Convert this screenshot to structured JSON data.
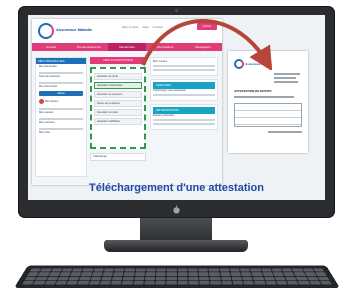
{
  "caption": "Téléchargement d'une attestation",
  "app": {
    "brand": "Assurance Maladie",
    "top_links": [
      "Mon compte",
      "Aide",
      "Contact"
    ],
    "logout_label": "Quitter",
    "nav": [
      {
        "label": "Accueil",
        "active": false
      },
      {
        "label": "Remboursements",
        "active": false
      },
      {
        "label": "Démarches",
        "active": true
      },
      {
        "label": "Informations",
        "active": false
      },
      {
        "label": "Messagerie",
        "active": false
      }
    ],
    "left_panel": {
      "title": "MES DÉMARCHES",
      "items": [
        "Mes demandes",
        "Suivi des dossiers",
        "Mes documents"
      ],
      "button_label": "Valider",
      "alert_label": "Mes alertes",
      "links": [
        "Mon espace",
        "Mes courriers",
        "Mes infos"
      ]
    },
    "middle_panel": {
      "title": "MES ATTESTATIONS",
      "items": [
        {
          "label": "Attestation de droits",
          "highlight": false
        },
        {
          "label": "Attestation d'indemnités",
          "highlight": true
        },
        {
          "label": "Attestation de paiement",
          "highlight": false
        },
        {
          "label": "Relevé de prestations",
          "highlight": false
        },
        {
          "label": "Attestation de vitale",
          "highlight": false
        },
        {
          "label": "Attestation d'affiliation",
          "highlight": false
        }
      ],
      "footer_label": "Télécharger"
    },
    "right_panel": {
      "cards": [
        {
          "title": "",
          "text": "Mon compte"
        },
        {
          "title": "SERVICES",
          "text": "Télécharger votre attestation"
        },
        {
          "title": "INFORMATIONS",
          "text": "Espace prévention"
        }
      ]
    }
  },
  "document": {
    "brand": "Assurance Maladie",
    "title": "ATTESTATION DE DROITS"
  },
  "colors": {
    "brand_blue": "#1d6fb8",
    "brand_pink": "#e23b7a",
    "highlight_green": "#2e9b4a",
    "caption_blue": "#1f4aa8",
    "arrow_red": "#b8453a"
  }
}
